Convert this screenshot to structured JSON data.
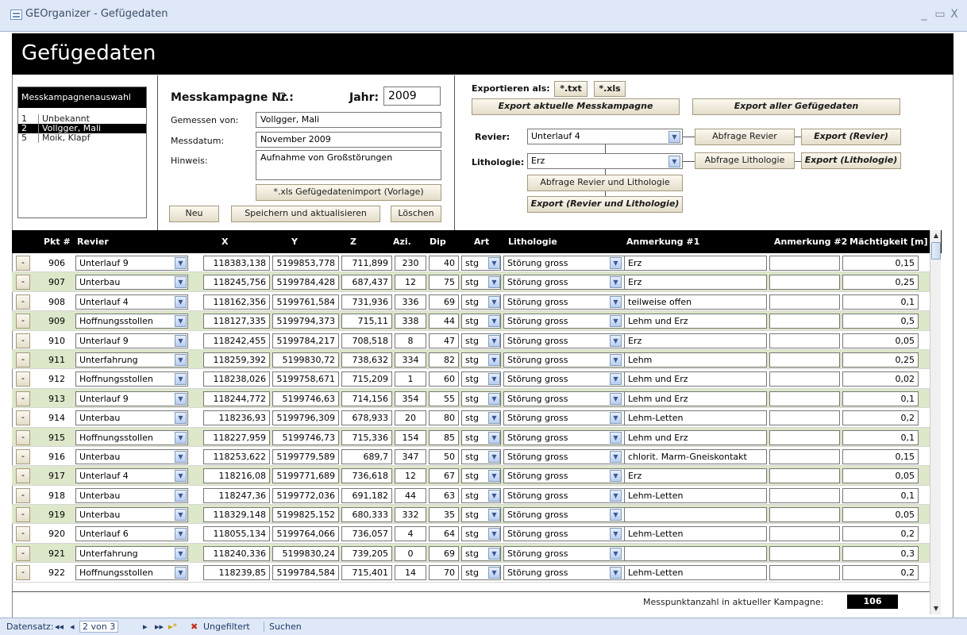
{
  "window": {
    "title": "GEOrganizer - Gefügedaten",
    "min": "_",
    "max": "▭",
    "close": "X"
  },
  "header": {
    "title": "Gefügedaten"
  },
  "campaign_list": {
    "header": "Messkampagnenauswahl",
    "items": [
      {
        "id": "1",
        "name": "Unbekannt",
        "selected": false
      },
      {
        "id": "2",
        "name": "Vollgger, Mali",
        "selected": true
      },
      {
        "id": "5",
        "name": "Moik, Klapf",
        "selected": false
      }
    ]
  },
  "campaign": {
    "nr_label": "Messkampagne Nr.:",
    "nr_value": "2",
    "year_label": "Jahr:",
    "year_value": "2009",
    "measured_by_label": "Gemessen von:",
    "measured_by_value": "Vollgger, Mali",
    "date_label": "Messdatum:",
    "date_value": "November 2009",
    "note_label": "Hinweis:",
    "note_value": "Aufnahme von Großstörungen",
    "import_button": "*.xls Gefügedatenimport (Vorlage)",
    "new_button": "Neu",
    "save_button": "Speichern und aktualisieren",
    "delete_button": "Löschen"
  },
  "export": {
    "as_label": "Exportieren als:",
    "txt_button": "*.txt",
    "xls_button": "*.xls",
    "current_button": "Export aktuelle Messkampagne",
    "all_button": "Export aller Gefügedaten",
    "revier_label": "Revier:",
    "revier_value": "Unterlauf 4",
    "query_revier_button": "Abfrage Revier",
    "export_revier_button": "Export (Revier)",
    "litho_label": "Lithologie:",
    "litho_value": "Erz",
    "query_litho_button": "Abfrage Lithologie",
    "export_litho_button": "Export (Lithologie)",
    "query_both_button": "Abfrage Revier und Lithologie",
    "export_both_button": "Export (Revier und Lithologie)"
  },
  "grid": {
    "columns": [
      "Pkt #",
      "Revier",
      "X",
      "Y",
      "Z",
      "Azi.",
      "Dip",
      "Art",
      "Lithologie",
      "Anmerkung #1",
      "Anmerkung #2",
      "Mächtigkeit [m]"
    ],
    "row_button": "-",
    "rows": [
      {
        "pkt": "906",
        "revier": "Unterlauf 9",
        "x": "118383,138",
        "y": "5199853,778",
        "z": "711,899",
        "azi": "230",
        "dip": "40",
        "art": "stg",
        "litho": "Störung gross",
        "a1": "Erz",
        "a2": "",
        "m": "0,15"
      },
      {
        "pkt": "907",
        "revier": "Unterbau",
        "x": "118245,756",
        "y": "5199784,428",
        "z": "687,437",
        "azi": "12",
        "dip": "75",
        "art": "stg",
        "litho": "Störung gross",
        "a1": "Erz",
        "a2": "",
        "m": "0,25"
      },
      {
        "pkt": "908",
        "revier": "Unterlauf 4",
        "x": "118162,356",
        "y": "5199761,584",
        "z": "731,936",
        "azi": "336",
        "dip": "69",
        "art": "stg",
        "litho": "Störung gross",
        "a1": "teilweise offen",
        "a2": "",
        "m": "0,1"
      },
      {
        "pkt": "909",
        "revier": "Hoffnungsstollen",
        "x": "118127,335",
        "y": "5199794,373",
        "z": "715,11",
        "azi": "338",
        "dip": "44",
        "art": "stg",
        "litho": "Störung gross",
        "a1": "Lehm und Erz",
        "a2": "",
        "m": "0,5"
      },
      {
        "pkt": "910",
        "revier": "Unterlauf 9",
        "x": "118242,455",
        "y": "5199784,217",
        "z": "708,518",
        "azi": "8",
        "dip": "47",
        "art": "stg",
        "litho": "Störung gross",
        "a1": "Erz",
        "a2": "",
        "m": "0,05"
      },
      {
        "pkt": "911",
        "revier": "Unterfahrung",
        "x": "118259,392",
        "y": "5199830,72",
        "z": "738,632",
        "azi": "334",
        "dip": "82",
        "art": "stg",
        "litho": "Störung gross",
        "a1": "Lehm",
        "a2": "",
        "m": "0,25"
      },
      {
        "pkt": "912",
        "revier": "Hoffnungsstollen",
        "x": "118238,026",
        "y": "5199758,671",
        "z": "715,209",
        "azi": "1",
        "dip": "60",
        "art": "stg",
        "litho": "Störung gross",
        "a1": "Lehm und Erz",
        "a2": "",
        "m": "0,02"
      },
      {
        "pkt": "913",
        "revier": "Unterlauf 9",
        "x": "118244,772",
        "y": "5199746,63",
        "z": "714,156",
        "azi": "354",
        "dip": "55",
        "art": "stg",
        "litho": "Störung gross",
        "a1": "Lehm und Erz",
        "a2": "",
        "m": "0,1"
      },
      {
        "pkt": "914",
        "revier": "Unterbau",
        "x": "118236,93",
        "y": "5199796,309",
        "z": "678,933",
        "azi": "20",
        "dip": "80",
        "art": "stg",
        "litho": "Störung gross",
        "a1": "Lehm-Letten",
        "a2": "",
        "m": "0,2"
      },
      {
        "pkt": "915",
        "revier": "Hoffnungsstollen",
        "x": "118227,959",
        "y": "5199746,73",
        "z": "715,336",
        "azi": "154",
        "dip": "85",
        "art": "stg",
        "litho": "Störung gross",
        "a1": "Lehm und Erz",
        "a2": "",
        "m": "0,1"
      },
      {
        "pkt": "916",
        "revier": "Unterbau",
        "x": "118253,622",
        "y": "5199779,589",
        "z": "689,7",
        "azi": "347",
        "dip": "50",
        "art": "stg",
        "litho": "Störung gross",
        "a1": "chlorit. Marm-Gneiskontakt",
        "a2": "",
        "m": "0,15"
      },
      {
        "pkt": "917",
        "revier": "Unterlauf 4",
        "x": "118216,08",
        "y": "5199771,689",
        "z": "736,618",
        "azi": "12",
        "dip": "67",
        "art": "stg",
        "litho": "Störung gross",
        "a1": "Erz",
        "a2": "",
        "m": "0,05"
      },
      {
        "pkt": "918",
        "revier": "Unterbau",
        "x": "118247,36",
        "y": "5199772,036",
        "z": "691,182",
        "azi": "44",
        "dip": "63",
        "art": "stg",
        "litho": "Störung gross",
        "a1": "Lehm-Letten",
        "a2": "",
        "m": "0,1"
      },
      {
        "pkt": "919",
        "revier": "Unterbau",
        "x": "118329,148",
        "y": "5199825,152",
        "z": "680,333",
        "azi": "332",
        "dip": "35",
        "art": "stg",
        "litho": "Störung gross",
        "a1": "",
        "a2": "",
        "m": "0,05"
      },
      {
        "pkt": "920",
        "revier": "Unterlauf 6",
        "x": "118055,134",
        "y": "5199764,066",
        "z": "736,057",
        "azi": "4",
        "dip": "64",
        "art": "stg",
        "litho": "Störung gross",
        "a1": "Lehm-Letten",
        "a2": "",
        "m": "0,2"
      },
      {
        "pkt": "921",
        "revier": "Unterfahrung",
        "x": "118240,336",
        "y": "5199830,24",
        "z": "739,205",
        "azi": "0",
        "dip": "69",
        "art": "stg",
        "litho": "Störung gross",
        "a1": "",
        "a2": "",
        "m": "0,3"
      },
      {
        "pkt": "922",
        "revier": "Hoffnungsstollen",
        "x": "118239,85",
        "y": "5199784,584",
        "z": "715,401",
        "azi": "14",
        "dip": "70",
        "art": "stg",
        "litho": "Störung gross",
        "a1": "Lehm-Letten",
        "a2": "",
        "m": "0,2"
      }
    ],
    "count_label": "Messpunktanzahl in aktueller Kampagne:",
    "count_value": "106"
  },
  "statusbar": {
    "record_label": "Datensatz:",
    "first": "◂◂",
    "prev": "◂",
    "position": "2 von 3",
    "next": "▸",
    "last": "▸▸",
    "new": "▸*",
    "filter": "Ungefiltert",
    "search": "Suchen"
  },
  "colors": {
    "header_bg": "#000000",
    "alt_row": "#dde7c9",
    "titlebar": "#dfe8f6"
  }
}
